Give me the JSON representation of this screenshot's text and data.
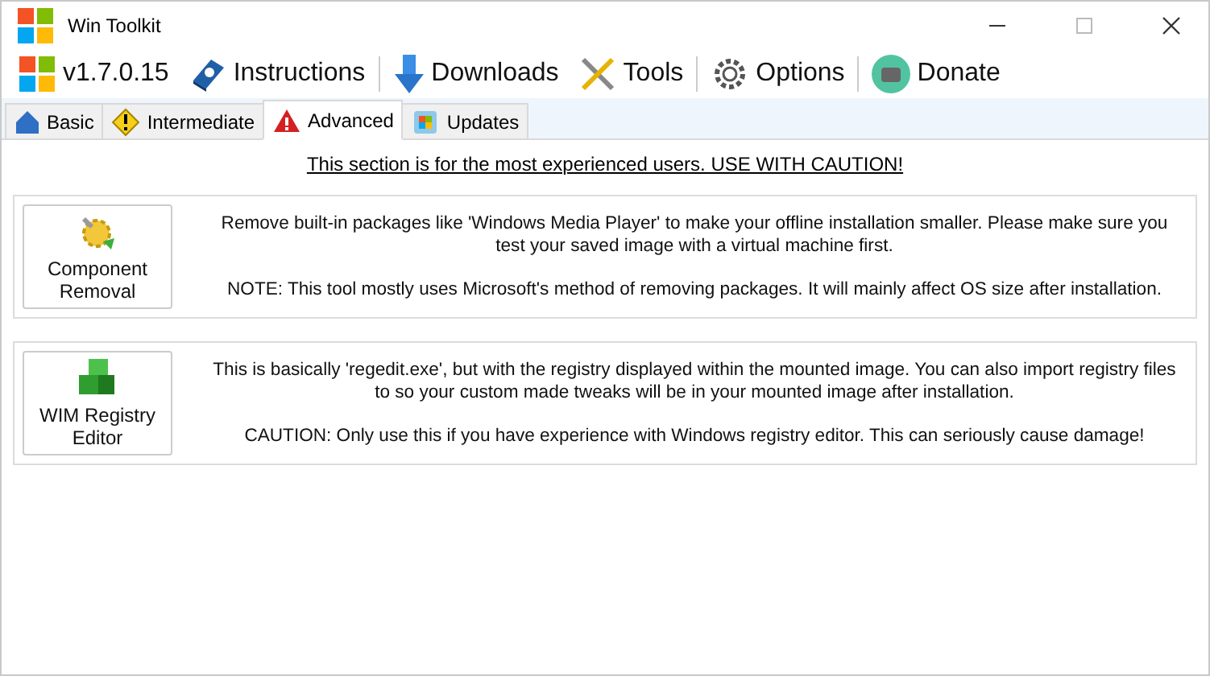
{
  "window": {
    "title": "Win Toolkit"
  },
  "menu": [
    {
      "label": "v1.7.0.15",
      "kind": "logo"
    },
    {
      "label": "Instructions",
      "kind": "book"
    },
    {
      "kind": "separator"
    },
    {
      "label": "Downloads",
      "kind": "download"
    },
    {
      "label": "Tools",
      "kind": "tools"
    },
    {
      "kind": "separator"
    },
    {
      "label": "Options",
      "kind": "gear"
    },
    {
      "kind": "separator"
    },
    {
      "label": "Donate",
      "kind": "wallet"
    }
  ],
  "tabs": [
    {
      "label": "Basic",
      "kind": "house",
      "selected": false
    },
    {
      "label": "Intermediate",
      "kind": "warning",
      "selected": false
    },
    {
      "label": "Advanced",
      "kind": "danger",
      "selected": true
    },
    {
      "label": "Updates",
      "kind": "update",
      "selected": false
    }
  ],
  "notice": "This section is for the most experienced users. USE WITH CAUTION!",
  "tools": [
    {
      "button": "Component Removal",
      "kind": "component",
      "paragraphs": [
        "Remove built-in packages like 'Windows Media Player' to make your offline installation smaller. Please make sure you test your saved image with a virtual machine first.",
        "NOTE: This tool mostly uses Microsoft's method of removing packages. It will mainly affect OS size after installation."
      ]
    },
    {
      "button": "WIM Registry Editor",
      "kind": "registry",
      "paragraphs": [
        "This is basically 'regedit.exe', but with the registry displayed within the mounted image.  You can also import registry files to so your custom made tweaks will be in your mounted image after installation.",
        "CAUTION: Only use this if you have experience with Windows registry editor. This can seriously cause damage!"
      ]
    }
  ]
}
